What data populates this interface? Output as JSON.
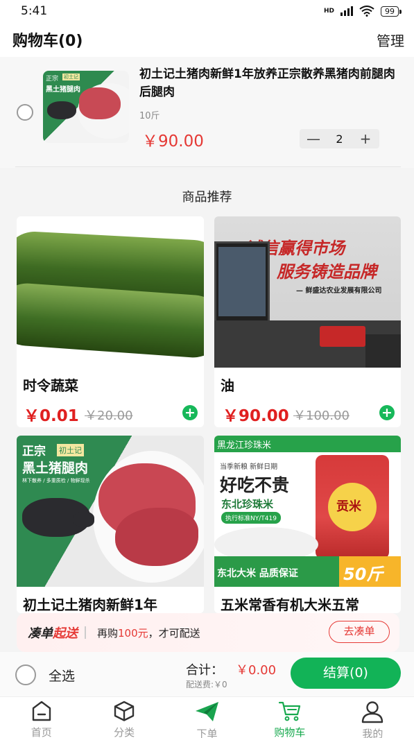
{
  "status_bar": {
    "time": "5:41",
    "network": "HD",
    "battery": "99"
  },
  "header": {
    "title": "购物车(0)",
    "manage": "管理"
  },
  "cart_item": {
    "name": "初土记土猪肉新鲜1年放养正宗散养黑猪肉前腿肉后腿肉",
    "spec": "10斤",
    "price": "￥90.00",
    "quantity": "2",
    "minus": "—",
    "plus": "+",
    "badge_top": "正宗",
    "badge_tag": "初土记",
    "badge_name": "黑土猪腿肉"
  },
  "recommend": {
    "title": "商品推荐",
    "products": [
      {
        "name": "时令蔬菜",
        "price": "￥0.01",
        "original": "￥20.00"
      },
      {
        "name": "油",
        "price": "￥90.00",
        "original": "￥100.00",
        "wall_text_1": "诚信赢得市场",
        "wall_text_2": "服务铸造品牌",
        "wall_text_3": "— 鲜盛达农业发展有限公司"
      },
      {
        "name": "初土记土猪肉新鲜1年",
        "tag1": "正宗",
        "tag2": "初土记",
        "subtitle": "黑土猪腿肉",
        "features": "林下散养 / 多重质检 / 物鲜现杀"
      },
      {
        "name": "五米常香有机大米五常",
        "strip": "黑龙江珍珠米",
        "line1": "当季新粮 新鲜日期",
        "big": "好吃不贵",
        "line2": "东北珍珠米",
        "std": "执行标准NY/T419",
        "bag": "贡米",
        "footer": "东北大米 品质保证",
        "weight": "50斤"
      }
    ]
  },
  "banner": {
    "part1": "凑单",
    "part2": "起送",
    "msg_prefix": "再购",
    "msg_amount": "100元",
    "msg_suffix": "，才可配送",
    "button": "去凑单"
  },
  "checkout": {
    "select_all": "全选",
    "total_label": "合计：",
    "total_value": "￥0.00",
    "shipping": "配送费:￥0",
    "pay_button": "结算(0)"
  },
  "tabbar": [
    {
      "label": "首页",
      "icon": "home-icon"
    },
    {
      "label": "分类",
      "icon": "category-icon"
    },
    {
      "label": "下单",
      "icon": "send-icon"
    },
    {
      "label": "购物车",
      "icon": "cart-icon"
    },
    {
      "label": "我的",
      "icon": "user-icon"
    }
  ],
  "colors": {
    "accent": "#12b357",
    "price": "#e53935"
  }
}
